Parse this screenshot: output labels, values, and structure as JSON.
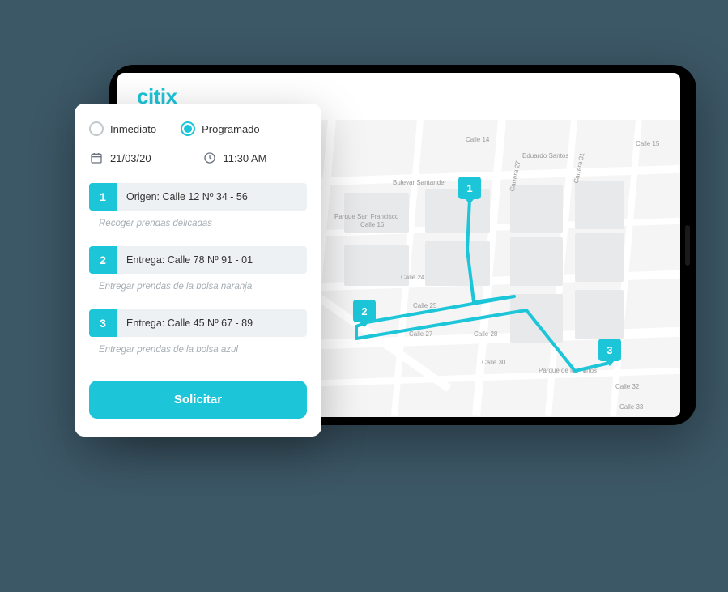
{
  "brand": "citix",
  "schedule": {
    "options": [
      {
        "label": "Inmediato",
        "selected": false
      },
      {
        "label": "Programado",
        "selected": true
      }
    ],
    "date": "21/03/20",
    "time": "11:30 AM"
  },
  "stops": [
    {
      "num": "1",
      "address": "Origen: Calle 12 Nº 34 - 56",
      "note": "Recoger prendas delicadas"
    },
    {
      "num": "2",
      "address": "Entrega: Calle 78 Nº 91 - 01",
      "note": "Entregar prendas de la bolsa naranja"
    },
    {
      "num": "3",
      "address": "Entrega: Calle 45 Nº 67 - 89",
      "note": "Entregar prendas de la bolsa azul"
    }
  ],
  "cta": "Solicitar",
  "map": {
    "pin1": "1",
    "pin2": "2",
    "pin3": "3",
    "labels": {
      "calle14": "Calle 14",
      "calle15": "Calle 15",
      "calle16": "Calle 16",
      "calle24": "Calle 24",
      "calle25": "Calle 25",
      "calle27": "Calle 27",
      "calle28": "Calle 28",
      "calle30": "Calle 30",
      "calle32": "Calle 32",
      "calle33": "Calle 33",
      "carrera27": "Carrera 27",
      "carrera31": "Carrera 31",
      "bulevar": "Bulevar Santander",
      "parque1": "Parque San Francisco",
      "parque2": "Parque de los Niños",
      "eduardos": "Eduardo Santos"
    }
  }
}
